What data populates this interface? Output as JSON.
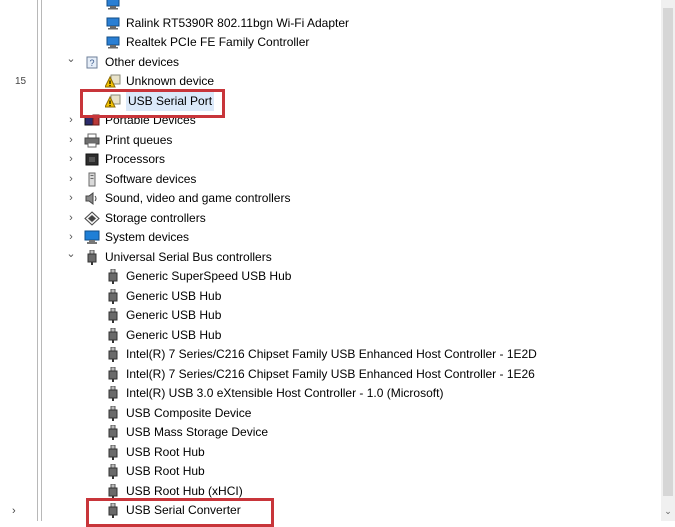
{
  "left_pane": {
    "text": "15",
    "chevron": "›"
  },
  "tree": {
    "rows": [
      {
        "label": "",
        "icon": "network-adapter-icon",
        "indent": 2,
        "exp": ""
      },
      {
        "label": "Ralink RT5390R 802.11bgn Wi-Fi Adapter",
        "icon": "network-adapter-icon",
        "indent": 2,
        "exp": ""
      },
      {
        "label": "Realtek PCIe FE Family Controller",
        "icon": "network-adapter-icon",
        "indent": 2,
        "exp": ""
      },
      {
        "label": "Other devices",
        "icon": "unknown-device-category-icon",
        "indent": 1,
        "exp": "⌄"
      },
      {
        "label": "Unknown device",
        "icon": "warning-device-icon",
        "indent": 2,
        "exp": ""
      },
      {
        "label": "USB Serial Port",
        "icon": "warning-device-icon",
        "indent": 2,
        "exp": ""
      },
      {
        "label": "Portable Devices",
        "icon": "portable-device-icon",
        "indent": 1,
        "exp": "›"
      },
      {
        "label": "Print queues",
        "icon": "printer-icon",
        "indent": 1,
        "exp": "›"
      },
      {
        "label": "Processors",
        "icon": "processor-icon",
        "indent": 1,
        "exp": "›"
      },
      {
        "label": "Software devices",
        "icon": "software-device-icon",
        "indent": 1,
        "exp": "›"
      },
      {
        "label": "Sound, video and game controllers",
        "icon": "speaker-icon",
        "indent": 1,
        "exp": "›"
      },
      {
        "label": "Storage controllers",
        "icon": "storage-controller-icon",
        "indent": 1,
        "exp": "›"
      },
      {
        "label": "System devices",
        "icon": "system-device-icon",
        "indent": 1,
        "exp": "›"
      },
      {
        "label": "Universal Serial Bus controllers",
        "icon": "usb-plug-icon",
        "indent": 1,
        "exp": "⌄"
      },
      {
        "label": "Generic SuperSpeed USB Hub",
        "icon": "usb-plug-icon",
        "indent": 2,
        "exp": ""
      },
      {
        "label": "Generic USB Hub",
        "icon": "usb-plug-icon",
        "indent": 2,
        "exp": ""
      },
      {
        "label": "Generic USB Hub",
        "icon": "usb-plug-icon",
        "indent": 2,
        "exp": ""
      },
      {
        "label": "Generic USB Hub",
        "icon": "usb-plug-icon",
        "indent": 2,
        "exp": ""
      },
      {
        "label": "Intel(R) 7 Series/C216 Chipset Family USB Enhanced Host Controller - 1E2D",
        "icon": "usb-plug-icon",
        "indent": 2,
        "exp": ""
      },
      {
        "label": "Intel(R) 7 Series/C216 Chipset Family USB Enhanced Host Controller - 1E26",
        "icon": "usb-plug-icon",
        "indent": 2,
        "exp": ""
      },
      {
        "label": "Intel(R) USB 3.0 eXtensible Host Controller - 1.0 (Microsoft)",
        "icon": "usb-plug-icon",
        "indent": 2,
        "exp": ""
      },
      {
        "label": "USB Composite Device",
        "icon": "usb-plug-icon",
        "indent": 2,
        "exp": ""
      },
      {
        "label": "USB Mass Storage Device",
        "icon": "usb-plug-icon",
        "indent": 2,
        "exp": ""
      },
      {
        "label": "USB Root Hub",
        "icon": "usb-plug-icon",
        "indent": 2,
        "exp": ""
      },
      {
        "label": "USB Root Hub",
        "icon": "usb-plug-icon",
        "indent": 2,
        "exp": ""
      },
      {
        "label": "USB Root Hub (xHCI)",
        "icon": "usb-plug-icon",
        "indent": 2,
        "exp": ""
      },
      {
        "label": "USB Serial Converter",
        "icon": "usb-plug-icon",
        "indent": 2,
        "exp": ""
      }
    ],
    "selected_index": 5,
    "highlighted_indices": [
      5,
      26
    ]
  },
  "colors": {
    "highlight_border": "#c8353a",
    "selection_bg": "#dbe9f9",
    "warning_yellow": "#f2c100",
    "folder_yellow": "#e8c46a",
    "monitor_blue": "#1e7fd6"
  }
}
